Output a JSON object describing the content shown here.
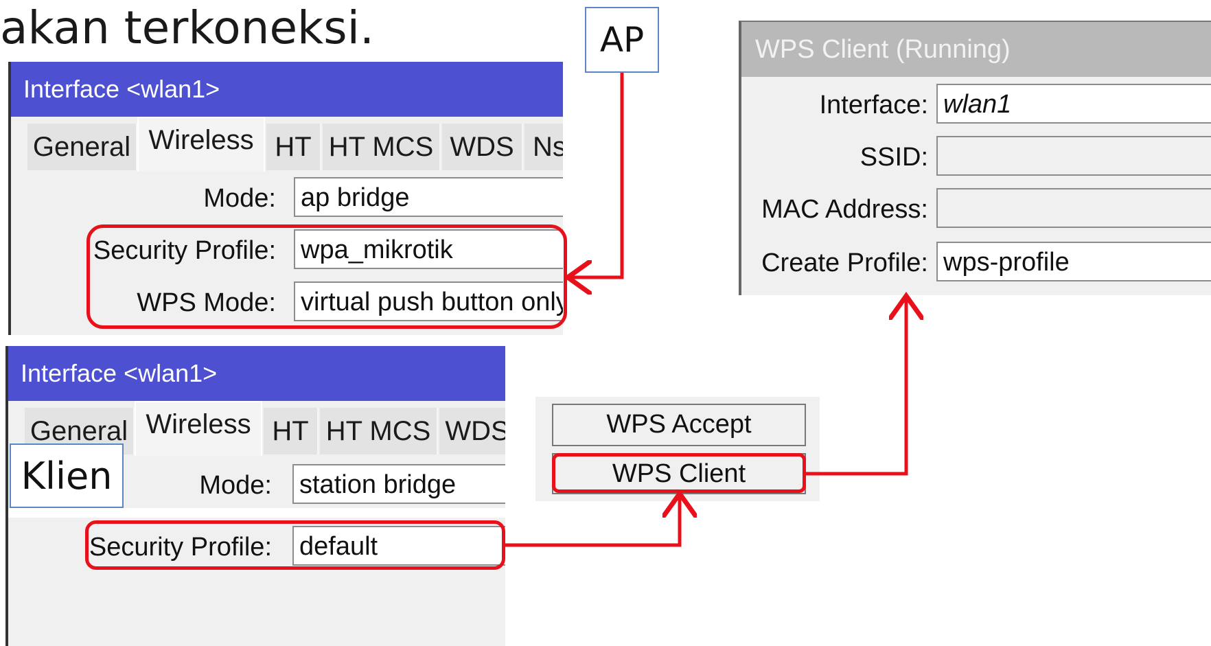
{
  "heading_text": "akan terkoneksi.",
  "callouts": {
    "ap": "AP",
    "klien": "Klien"
  },
  "ap_window": {
    "title": "Interface <wlan1>",
    "tabs": [
      "General",
      "Wireless",
      "HT",
      "HT MCS",
      "WDS",
      "Nst"
    ],
    "active_tab": "Wireless",
    "mode_label": "Mode:",
    "mode_value": "ap bridge",
    "security_label": "Security Profile:",
    "security_value": "wpa_mikrotik",
    "wps_mode_label": "WPS Mode:",
    "wps_mode_value": "virtual push button only"
  },
  "client_window": {
    "title": "Interface <wlan1>",
    "tabs": [
      "General",
      "Wireless",
      "HT",
      "HT MCS",
      "WDS"
    ],
    "active_tab": "Wireless",
    "mode_label": "Mode:",
    "mode_value": "station bridge",
    "security_label": "Security Profile:",
    "security_value": "default"
  },
  "wps_buttons": {
    "accept": "WPS Accept",
    "client": "WPS Client"
  },
  "wps_client_window": {
    "title": "WPS Client (Running)",
    "interface_label": "Interface:",
    "interface_value": "wlan1",
    "ssid_label": "SSID:",
    "ssid_value": "",
    "mac_label": "MAC Address:",
    "mac_value": "",
    "profile_label": "Create Profile:",
    "profile_value": "wps-profile"
  },
  "colors": {
    "titlebar": "#4d50d0",
    "highlight": "#e8101a",
    "callout_border": "#5b86c4"
  }
}
